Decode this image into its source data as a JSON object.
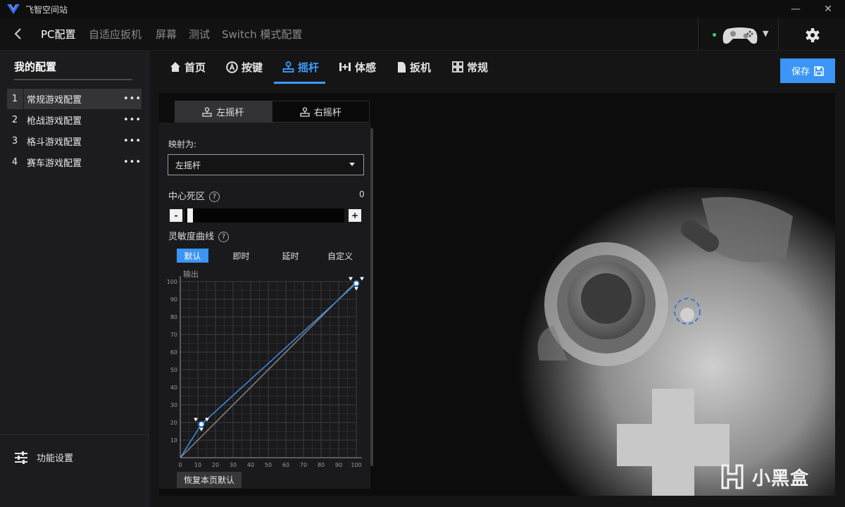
{
  "app": {
    "title": "飞智空间站",
    "minimize": "—",
    "close": "✕"
  },
  "nav": {
    "items": [
      "PC配置",
      "自适应扳机",
      "屏幕",
      "测试",
      "Switch 模式配置"
    ]
  },
  "sidebar": {
    "heading": "我的配置",
    "profiles": [
      {
        "num": "1",
        "name": "常规游戏配置",
        "more": "•••"
      },
      {
        "num": "2",
        "name": "枪战游戏配置",
        "more": "•••"
      },
      {
        "num": "3",
        "name": "格斗游戏配置",
        "more": "•••"
      },
      {
        "num": "4",
        "name": "赛车游戏配置",
        "more": "•••"
      }
    ],
    "func_settings": "功能设置"
  },
  "tabs": [
    {
      "label": "首页",
      "icon": "home-icon"
    },
    {
      "label": "按键",
      "icon": "button-a-icon"
    },
    {
      "label": "摇杆",
      "icon": "joystick-icon"
    },
    {
      "label": "体感",
      "icon": "motion-icon"
    },
    {
      "label": "扳机",
      "icon": "trigger-icon"
    },
    {
      "label": "常规",
      "icon": "grid-icon"
    }
  ],
  "save_label": "保存",
  "stick_tabs": {
    "left": "左摇杆",
    "right": "右摇杆"
  },
  "mapping": {
    "label": "映射为:",
    "value": "左摇杆"
  },
  "deadzone": {
    "label": "中心死区",
    "value": "0",
    "minus": "-",
    "plus": "+",
    "level": 0
  },
  "sensitivity": {
    "label": "灵敏度曲线",
    "options": [
      "默认",
      "即时",
      "延时",
      "自定义"
    ],
    "selected": "默认"
  },
  "reset_label": "恢复本页默认",
  "watermark": "小黑盒",
  "accent": "#3a95f5",
  "chart_data": {
    "type": "line",
    "ylabel": "输出",
    "xlim": [
      0,
      100
    ],
    "ylim": [
      0,
      100
    ],
    "x_ticks": [
      "0",
      "10",
      "20",
      "30",
      "40",
      "50",
      "60",
      "70",
      "80",
      "90",
      "100"
    ],
    "y_ticks": [
      "10",
      "20",
      "30",
      "40",
      "50",
      "60",
      "70",
      "80",
      "90",
      "100"
    ],
    "grid": true,
    "series": [
      {
        "x": [
          0,
          12,
          100
        ],
        "y": [
          0,
          19,
          99
        ],
        "color": "#3a95f5"
      },
      {
        "x": [
          0,
          100
        ],
        "y": [
          0,
          100
        ],
        "color": "#8a8a8a"
      }
    ],
    "handles": [
      {
        "x": 12,
        "y": 19
      },
      {
        "x": 100,
        "y": 99
      }
    ]
  }
}
